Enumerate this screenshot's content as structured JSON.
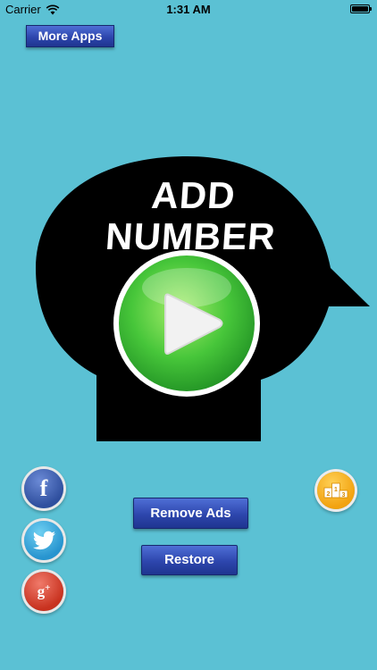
{
  "status_bar": {
    "carrier": "Carrier",
    "time": "1:31 AM",
    "battery_level": 1.0
  },
  "header": {
    "more_apps_label": "More Apps"
  },
  "logo": {
    "title": "ADD NUMBER",
    "play_icon": "play-icon"
  },
  "buttons": {
    "remove_ads_label": "Remove Ads",
    "restore_label": "Restore"
  },
  "social": {
    "facebook_glyph": "f",
    "twitter_icon": "twitter-bird-icon",
    "google_plus_glyph": "g",
    "google_plus_sup": "+"
  },
  "leaderboard": {
    "icon": "podium-icon",
    "places": [
      "2",
      "1",
      "3"
    ]
  },
  "colors": {
    "background": "#5bc1d4",
    "head": "#000000",
    "play_green": "#3fbf3a",
    "button_blue": "#2d46ad",
    "leaderboard_orange": "#f2a20f"
  }
}
